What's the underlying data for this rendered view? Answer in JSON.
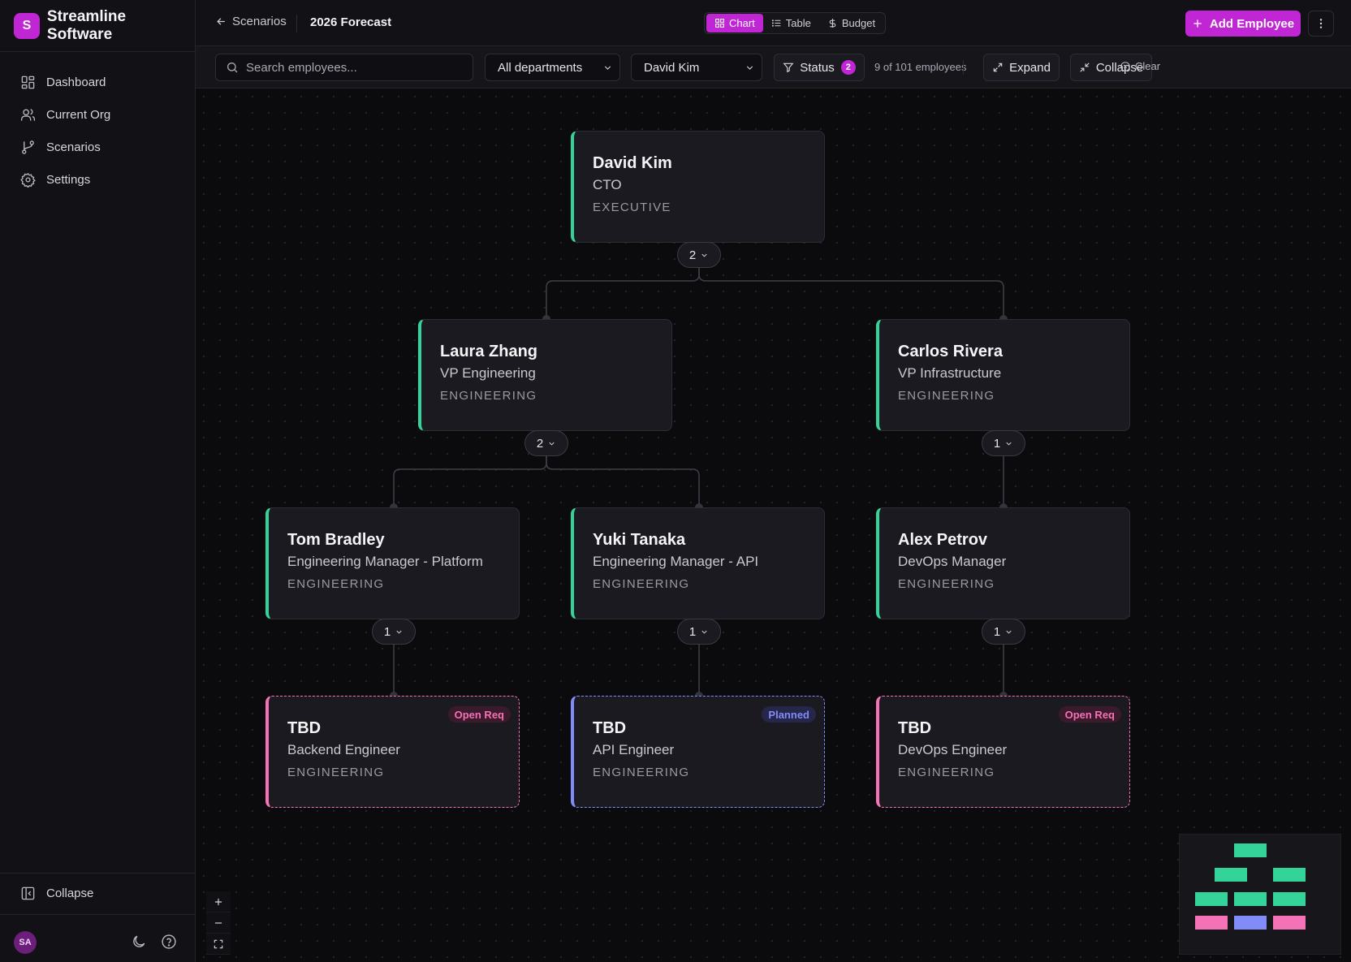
{
  "brand": {
    "logo_letter": "S",
    "name": "Streamline Software"
  },
  "sidebar": {
    "items": [
      {
        "label": "Dashboard",
        "icon": "dashboard-icon"
      },
      {
        "label": "Current Org",
        "icon": "users-icon"
      },
      {
        "label": "Scenarios",
        "icon": "git-branch-icon"
      },
      {
        "label": "Settings",
        "icon": "gear-icon"
      }
    ],
    "collapse_label": "Collapse",
    "avatar_initials": "SA"
  },
  "header": {
    "back_label": "Scenarios",
    "scenario_title": "2026 Forecast",
    "views": [
      {
        "label": "Chart",
        "active": true
      },
      {
        "label": "Table",
        "active": false
      },
      {
        "label": "Budget",
        "active": false
      }
    ],
    "add_employee_label": "Add Employee"
  },
  "toolbar": {
    "search_placeholder": "Search employees...",
    "department_select": "All departments",
    "manager_select": "David Kim",
    "status_label": "Status",
    "status_count": "2",
    "employee_count_text": "9 of 101 employees",
    "expand_label": "Expand",
    "collapse_label": "Collapse",
    "clear_label": "Clear"
  },
  "org_chart": {
    "nodes": [
      {
        "name": "David Kim",
        "title": "CTO",
        "department": "EXECUTIVE",
        "direct_reports": "2"
      },
      {
        "name": "Laura Zhang",
        "title": "VP Engineering",
        "department": "ENGINEERING",
        "direct_reports": "2"
      },
      {
        "name": "Carlos Rivera",
        "title": "VP Infrastructure",
        "department": "ENGINEERING",
        "direct_reports": "1"
      },
      {
        "name": "Tom Bradley",
        "title": "Engineering Manager - Platform",
        "department": "ENGINEERING",
        "direct_reports": "1"
      },
      {
        "name": "Yuki Tanaka",
        "title": "Engineering Manager - API",
        "department": "ENGINEERING",
        "direct_reports": "1"
      },
      {
        "name": "Alex Petrov",
        "title": "DevOps Manager",
        "department": "ENGINEERING",
        "direct_reports": "1"
      },
      {
        "name": "TBD",
        "title": "Backend Engineer",
        "department": "ENGINEERING",
        "status": "Open Req"
      },
      {
        "name": "TBD",
        "title": "API Engineer",
        "department": "ENGINEERING",
        "status": "Planned"
      },
      {
        "name": "TBD",
        "title": "DevOps Engineer",
        "department": "ENGINEERING",
        "status": "Open Req"
      }
    ]
  },
  "colors": {
    "accent": "#c026d3",
    "filled": "#34d399",
    "open_req": "#f472b6",
    "planned": "#818cf8"
  }
}
